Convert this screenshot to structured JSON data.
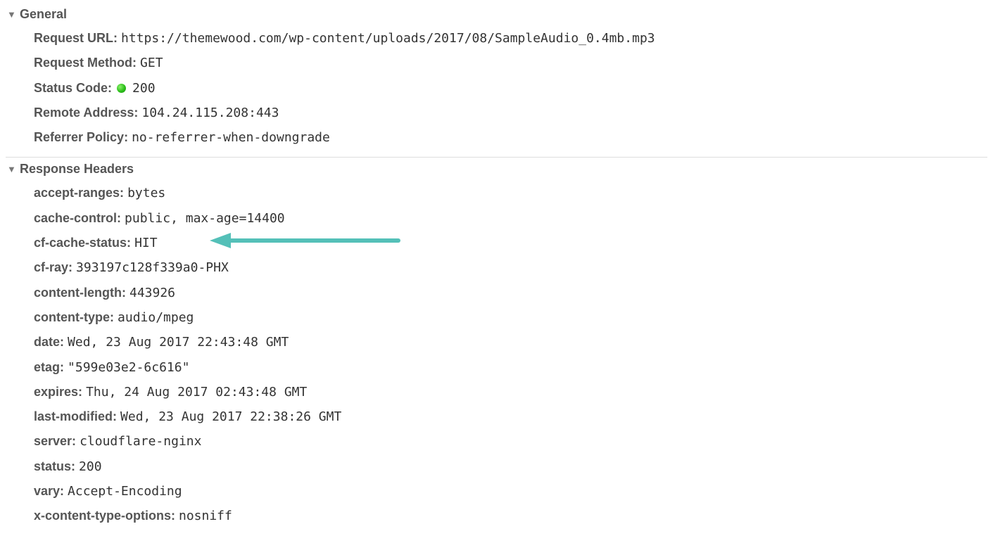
{
  "sections": {
    "general": {
      "title": "General",
      "items": {
        "request_url": {
          "label": "Request URL:",
          "value": "https://themewood.com/wp-content/uploads/2017/08/SampleAudio_0.4mb.mp3"
        },
        "request_method": {
          "label": "Request Method:",
          "value": "GET"
        },
        "status_code": {
          "label": "Status Code:",
          "value": "200"
        },
        "remote_address": {
          "label": "Remote Address:",
          "value": "104.24.115.208:443"
        },
        "referrer_policy": {
          "label": "Referrer Policy:",
          "value": "no-referrer-when-downgrade"
        }
      }
    },
    "response_headers": {
      "title": "Response Headers",
      "items": {
        "accept_ranges": {
          "label": "accept-ranges:",
          "value": "bytes"
        },
        "cache_control": {
          "label": "cache-control:",
          "value": "public, max-age=14400"
        },
        "cf_cache_status": {
          "label": "cf-cache-status:",
          "value": "HIT"
        },
        "cf_ray": {
          "label": "cf-ray:",
          "value": "393197c128f339a0-PHX"
        },
        "content_length": {
          "label": "content-length:",
          "value": "443926"
        },
        "content_type": {
          "label": "content-type:",
          "value": "audio/mpeg"
        },
        "date": {
          "label": "date:",
          "value": "Wed, 23 Aug 2017 22:43:48 GMT"
        },
        "etag": {
          "label": "etag:",
          "value": "\"599e03e2-6c616\""
        },
        "expires": {
          "label": "expires:",
          "value": "Thu, 24 Aug 2017 02:43:48 GMT"
        },
        "last_modified": {
          "label": "last-modified:",
          "value": "Wed, 23 Aug 2017 22:38:26 GMT"
        },
        "server": {
          "label": "server:",
          "value": "cloudflare-nginx"
        },
        "status": {
          "label": "status:",
          "value": "200"
        },
        "vary": {
          "label": "vary:",
          "value": "Accept-Encoding"
        },
        "x_content_type_options": {
          "label": "x-content-type-options:",
          "value": "nosniff"
        }
      }
    }
  },
  "annotation": {
    "arrow_color": "#54c0b8"
  }
}
